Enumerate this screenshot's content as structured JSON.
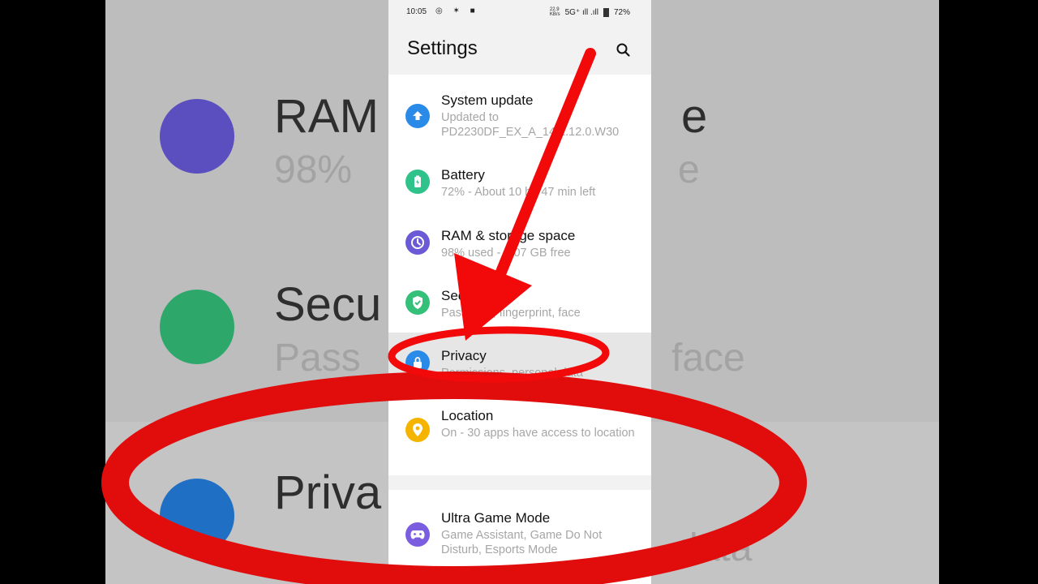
{
  "status": {
    "time": "10:05",
    "left_icons": "◎ ✶ ■",
    "net_speed_top": "22.9",
    "net_speed_bottom": "KB/s",
    "signal": "5G⁺ ıll .ıll",
    "battery": "72%"
  },
  "header": {
    "title": "Settings",
    "search_icon": "search-icon"
  },
  "items": [
    {
      "title": "System update",
      "subtitle": "Updated to PD2230DF_EX_A_14.1.12.0.W30",
      "icon": "upload-arrow-icon",
      "color": "#2a8ae8"
    },
    {
      "title": "Battery",
      "subtitle": "72% - About 10 hr, 47 min left",
      "icon": "battery-icon",
      "color": "#2fc28a"
    },
    {
      "title": "RAM & storage space",
      "subtitle": "98% used - 2.07 GB free",
      "icon": "pie-clock-icon",
      "color": "#6a5ad6"
    },
    {
      "title": "Security",
      "subtitle": "Password, fingerprint, face",
      "icon": "shield-check-icon",
      "color": "#35c07a"
    },
    {
      "title": "Privacy",
      "subtitle": "Permissions, personal data",
      "icon": "lock-icon",
      "color": "#2a8ae8"
    },
    {
      "title": "Location",
      "subtitle": "On - 30 apps have access to location",
      "icon": "location-pin-icon",
      "color": "#f4b400"
    },
    {
      "title": "Ultra Game Mode",
      "subtitle": "Game Assistant, Game Do Not Disturb, Esports Mode",
      "icon": "gamepad-icon",
      "color": "#7b5de0"
    }
  ],
  "background_zoom": {
    "row1_title": "RAM",
    "row1_title_tail": "e",
    "row1_sub": "98%",
    "row1_sub_tail": "e",
    "row2_title": "Secu",
    "row2_sub": "Pass",
    "row2_sub_tail": "face",
    "row3_title": "Priva",
    "row3_sub_tail": "data"
  },
  "annotation": {
    "arrow_color": "#f20a0a",
    "circle_color": "#f20a0a"
  }
}
